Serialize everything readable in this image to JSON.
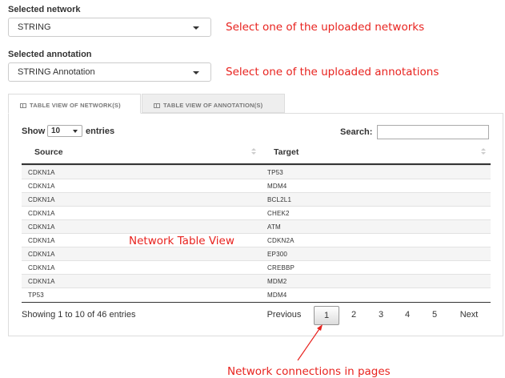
{
  "network": {
    "label": "Selected network",
    "value": "STRING",
    "annotation": "Select one of the uploaded networks"
  },
  "annotation_select": {
    "label": "Selected annotation",
    "value": "STRING Annotation",
    "annotation": "Select one of the uploaded annotations"
  },
  "tabs": [
    {
      "label": "TABLE VIEW OF NETWORK(S)",
      "icon": "table-icon",
      "active": true
    },
    {
      "label": "TABLE VIEW OF ANNOTATION(S)",
      "icon": "table-icon",
      "active": false
    }
  ],
  "table": {
    "show_label": "Show",
    "page_length": "10",
    "entries_label": "entries",
    "search_label": "Search:",
    "search_value": "",
    "columns": [
      "Source",
      "Target"
    ],
    "rows": [
      [
        "CDKN1A",
        "TP53"
      ],
      [
        "CDKN1A",
        "MDM4"
      ],
      [
        "CDKN1A",
        "BCL2L1"
      ],
      [
        "CDKN1A",
        "CHEK2"
      ],
      [
        "CDKN1A",
        "ATM"
      ],
      [
        "CDKN1A",
        "CDKN2A"
      ],
      [
        "CDKN1A",
        "EP300"
      ],
      [
        "CDKN1A",
        "CREBBP"
      ],
      [
        "CDKN1A",
        "MDM2"
      ],
      [
        "TP53",
        "MDM4"
      ]
    ],
    "info": "Showing 1 to 10 of 46 entries",
    "overlay_annotation": "Network Table View"
  },
  "pagination": {
    "previous": "Previous",
    "pages": [
      "1",
      "2",
      "3",
      "4",
      "5"
    ],
    "current": "1",
    "next": "Next",
    "annotation": "Network connections in pages"
  },
  "colors": {
    "annotation_red": "#e8231f",
    "border": "#dddddd",
    "row_stripe": "#f5f5f5"
  }
}
